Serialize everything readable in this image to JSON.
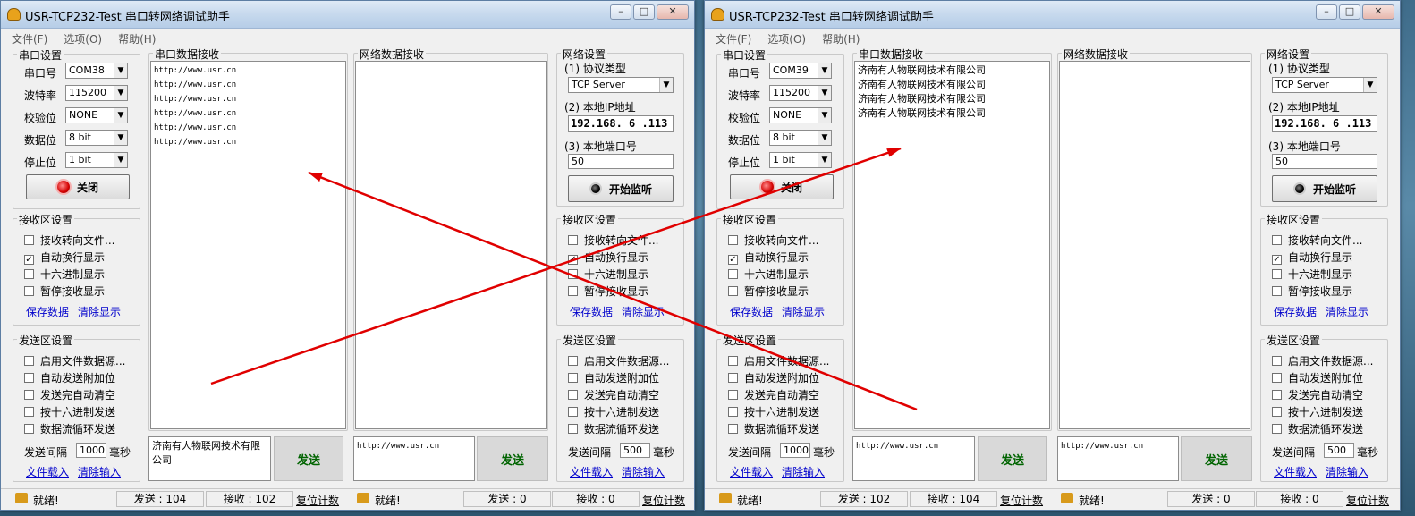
{
  "left": {
    "title": "USR-TCP232-Test 串口转网络调试助手",
    "menu": [
      "文件(F)",
      "选项(O)",
      "帮助(H)"
    ],
    "serial": {
      "group_title": "串口设置",
      "port_label": "串口号",
      "port": "COM38",
      "baud_label": "波特率",
      "baud": "115200",
      "parity_label": "校验位",
      "parity": "NONE",
      "databits_label": "数据位",
      "databits": "8 bit",
      "stopbits_label": "停止位",
      "stopbits": "1 bit",
      "button": "关闭"
    },
    "recv_settings": {
      "group_title": "接收区设置",
      "items": [
        "接收转向文件...",
        "自动换行显示",
        "十六进制显示",
        "暂停接收显示"
      ],
      "save": "保存数据",
      "clear": "清除显示"
    },
    "send_settings": {
      "group_title": "发送区设置",
      "items": [
        "启用文件数据源...",
        "自动发送附加位",
        "发送完自动清空",
        "按十六进制发送",
        "数据流循环发送"
      ],
      "interval_label": "发送间隔",
      "interval": "1000",
      "interval_unit": "毫秒",
      "load": "文件载入",
      "clear_input": "清除输入"
    },
    "serial_recv": {
      "title": "串口数据接收",
      "lines": [
        "http://www.usr.cn",
        "http://www.usr.cn",
        "http://www.usr.cn",
        "http://www.usr.cn",
        "http://www.usr.cn",
        "http://www.usr.cn"
      ]
    },
    "net_recv": {
      "title": "网络数据接收"
    },
    "serial_send_text": "济南有人物联网技术有限公司",
    "net_send_text": "http://www.usr.cn",
    "send_label": "发送",
    "net": {
      "group_title": "网络设置",
      "protocol_label": "(1) 协议类型",
      "protocol": "TCP Server",
      "ip_label": "(2) 本地IP地址",
      "ip": "192.168. 6 .113",
      "port_label": "(3) 本地端口号",
      "port": "50",
      "button": "开始监听"
    },
    "net_recv_settings": {
      "group_title": "接收区设置",
      "items": [
        "接收转向文件...",
        "自动换行显示",
        "十六进制显示",
        "暂停接收显示"
      ],
      "save": "保存数据",
      "clear": "清除显示"
    },
    "net_send_settings": {
      "group_title": "发送区设置",
      "items": [
        "启用文件数据源...",
        "自动发送附加位",
        "发送完自动清空",
        "按十六进制发送",
        "数据流循环发送"
      ],
      "interval_label": "发送间隔",
      "interval": "500",
      "interval_unit": "毫秒",
      "load": "文件载入",
      "clear_input": "清除输入"
    },
    "status": {
      "ready1": "就绪!",
      "sent1": "发送 : 104",
      "recv1": "接收 : 102",
      "reset1": "复位计数",
      "ready2": "就绪!",
      "sent2": "发送 : 0",
      "recv2": "接收 : 0",
      "reset2": "复位计数"
    }
  },
  "right": {
    "title": "USR-TCP232-Test 串口转网络调试助手",
    "menu": [
      "文件(F)",
      "选项(O)",
      "帮助(H)"
    ],
    "serial": {
      "group_title": "串口设置",
      "port_label": "串口号",
      "port": "COM39",
      "baud_label": "波特率",
      "baud": "115200",
      "parity_label": "校验位",
      "parity": "NONE",
      "databits_label": "数据位",
      "databits": "8 bit",
      "stopbits_label": "停止位",
      "stopbits": "1 bit",
      "button": "关闭"
    },
    "recv_settings": {
      "group_title": "接收区设置",
      "items": [
        "接收转向文件...",
        "自动换行显示",
        "十六进制显示",
        "暂停接收显示"
      ],
      "save": "保存数据",
      "clear": "清除显示"
    },
    "send_settings": {
      "group_title": "发送区设置",
      "items": [
        "启用文件数据源...",
        "自动发送附加位",
        "发送完自动清空",
        "按十六进制发送",
        "数据流循环发送"
      ],
      "interval_label": "发送间隔",
      "interval": "1000",
      "interval_unit": "毫秒",
      "load": "文件载入",
      "clear_input": "清除输入"
    },
    "serial_recv": {
      "title": "串口数据接收",
      "lines": [
        "济南有人物联网技术有限公司",
        "济南有人物联网技术有限公司",
        "济南有人物联网技术有限公司",
        "济南有人物联网技术有限公司"
      ]
    },
    "net_recv": {
      "title": "网络数据接收"
    },
    "serial_send_text": "http://www.usr.cn",
    "net_send_text": "http://www.usr.cn",
    "send_label": "发送",
    "net": {
      "group_title": "网络设置",
      "protocol_label": "(1) 协议类型",
      "protocol": "TCP Server",
      "ip_label": "(2) 本地IP地址",
      "ip": "192.168. 6 .113",
      "port_label": "(3) 本地端口号",
      "port": "50",
      "button": "开始监听"
    },
    "net_recv_settings": {
      "group_title": "接收区设置",
      "items": [
        "接收转向文件...",
        "自动换行显示",
        "十六进制显示",
        "暂停接收显示"
      ],
      "save": "保存数据",
      "clear": "清除显示"
    },
    "net_send_settings": {
      "group_title": "发送区设置",
      "items": [
        "启用文件数据源...",
        "自动发送附加位",
        "发送完自动清空",
        "按十六进制发送",
        "数据流循环发送"
      ],
      "interval_label": "发送间隔",
      "interval": "500",
      "interval_unit": "毫秒",
      "load": "文件载入",
      "clear_input": "清除输入"
    },
    "status": {
      "ready1": "就绪!",
      "sent1": "发送 : 102",
      "recv1": "接收 : 104",
      "reset1": "复位计数",
      "ready2": "就绪!",
      "sent2": "发送 : 0",
      "recv2": "接收 : 0",
      "reset2": "复位计数"
    }
  },
  "annotation_color": "#e00000"
}
